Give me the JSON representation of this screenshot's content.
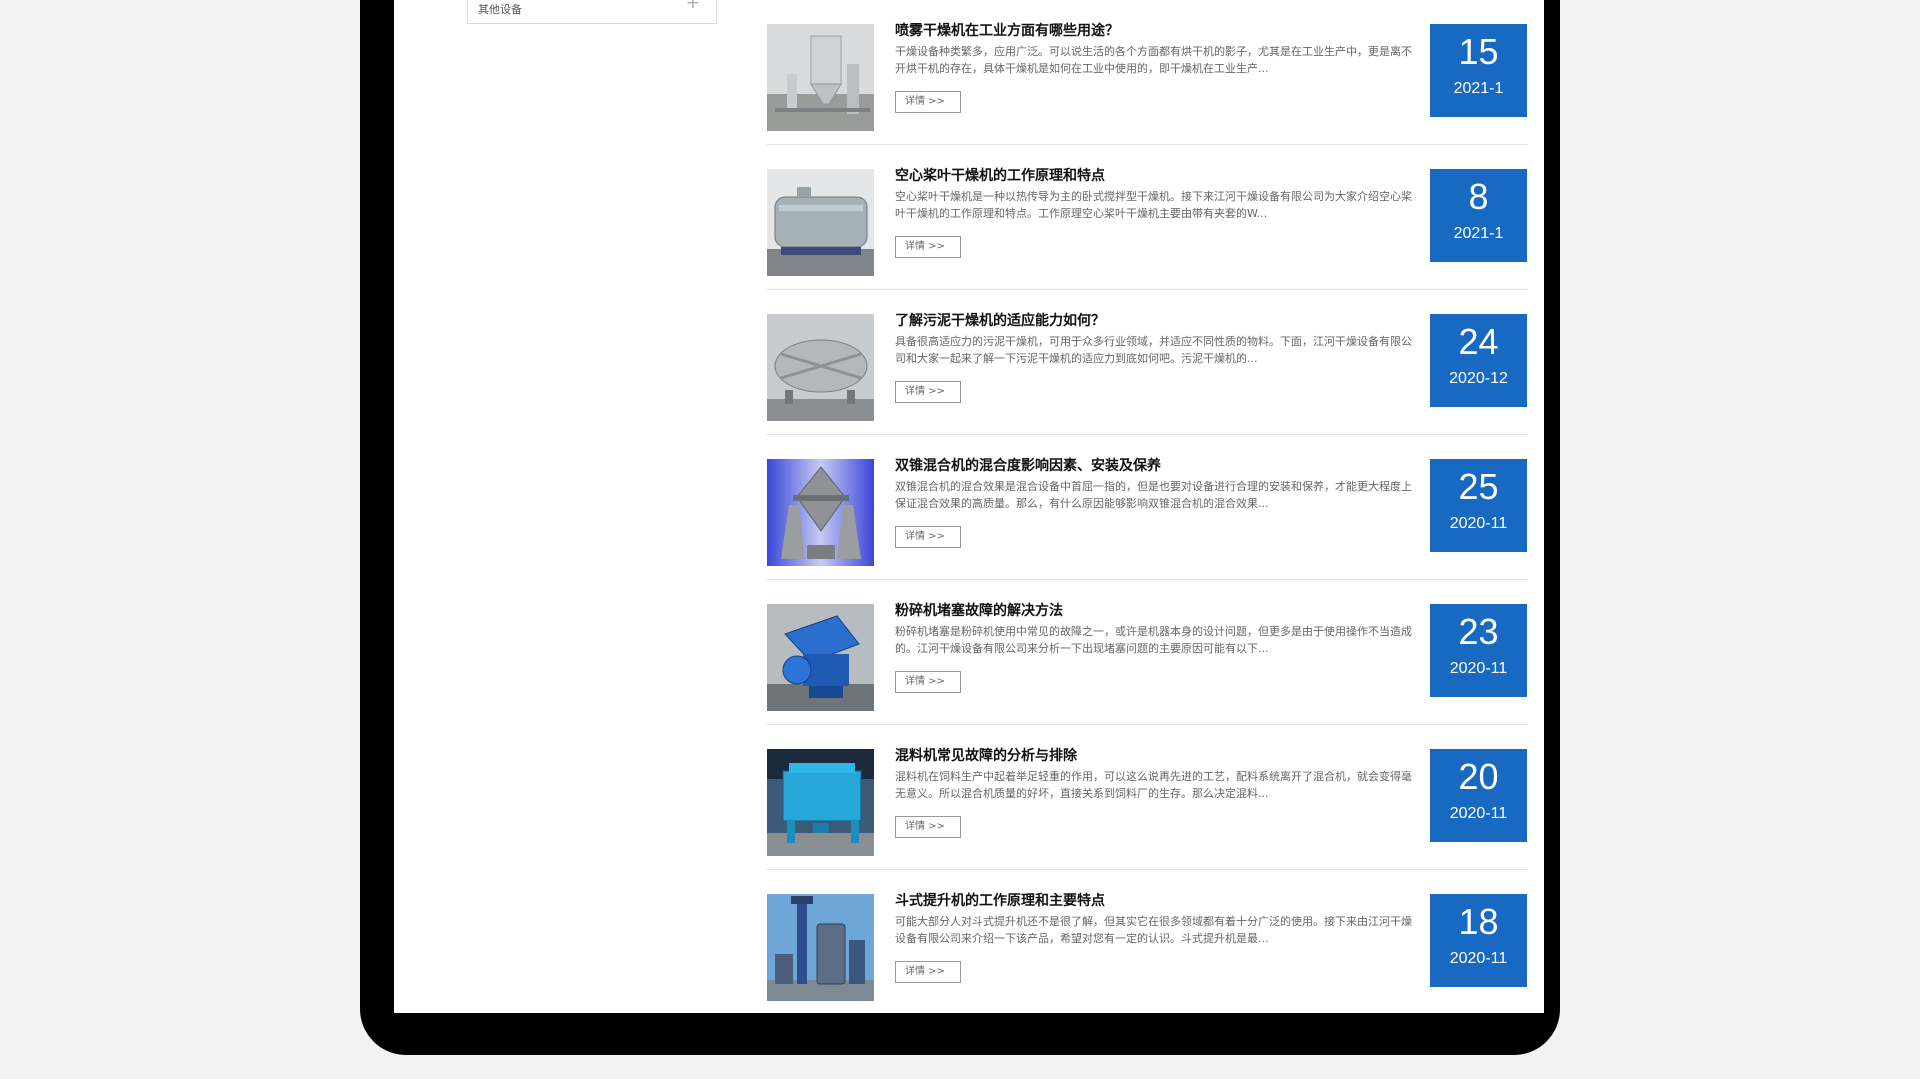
{
  "sidebar": {
    "other_equipment_label": "其他设备",
    "expand_glyph": "+"
  },
  "news": {
    "detail_label": "详情 >>",
    "items": [
      {
        "title": "喷雾干燥机在工业方面有哪些用途？",
        "excerpt": "干燥设备种类繁多，应用广泛。可以说生活的各个方面都有烘干机的影子，尤其是在工业生产中，更是离不开烘干机的存在，具体干燥机是如何在工业中使用的，即干燥机在工业生产...",
        "day": "15",
        "ym": "2021-1",
        "image": "spray-dryer-photo"
      },
      {
        "title": "空心桨叶干燥机的工作原理和特点",
        "excerpt": "空心桨叶干燥机是一种以热传导为主的卧式搅拌型干燥机。接下来江河干燥设备有限公司为大家介绍空心桨叶干燥机的工作原理和特点。工作原理空心桨叶干燥机主要由带有夹套的W...",
        "day": "8",
        "ym": "2021-1",
        "image": "paddle-dryer-photo"
      },
      {
        "title": "了解污泥干燥机的适应能力如何？",
        "excerpt": "具备很高适应力的污泥干燥机，可用于众多行业领域，并适应不同性质的物料。下面，江河干燥设备有限公司和大家一起来了解一下污泥干燥机的适应力到底如何吧。污泥干燥机的...",
        "day": "24",
        "ym": "2020-12",
        "image": "sludge-dryer-photo"
      },
      {
        "title": "双锥混合机的混合度影响因素、安装及保养",
        "excerpt": "双锥混合机的混合效果是混合设备中首屈一指的，但是也要对设备进行合理的安装和保养，才能更大程度上保证混合效果的高质量。那么，有什么原因能够影响双锥混合机的混合效果...",
        "day": "25",
        "ym": "2020-11",
        "image": "double-cone-mixer-photo"
      },
      {
        "title": "粉碎机堵塞故障的解决方法",
        "excerpt": "粉碎机堵塞是粉碎机使用中常见的故障之一，或许是机器本身的设计问题，但更多是由于使用操作不当造成的。江河干燥设备有限公司来分析一下出现堵塞问题的主要原因可能有以下...",
        "day": "23",
        "ym": "2020-11",
        "image": "crusher-photo"
      },
      {
        "title": "混料机常见故障的分析与排除",
        "excerpt": "混料机在饲料生产中起着举足轻重的作用，可以这么说再先进的工艺，配料系统离开了混合机，就会变得毫无意义。所以混合机质量的好坏，直接关系到饲料厂的生存。那么决定混料...",
        "day": "20",
        "ym": "2020-11",
        "image": "ribbon-mixer-photo"
      },
      {
        "title": "斗式提升机的工作原理和主要特点",
        "excerpt": "可能大部分人对斗式提升机还不是很了解，但其实它在很多领域都有着十分广泛的使用。接下来由江河干燥设备有限公司来介绍一下该产品，希望对您有一定的认识。斗式提升机是最...",
        "day": "18",
        "ym": "2020-11",
        "image": "bucket-elevator-photo"
      }
    ]
  },
  "colors": {
    "badge_blue": "#1769c2",
    "frame": "#000000",
    "page_bg": "#f2f2f2"
  }
}
